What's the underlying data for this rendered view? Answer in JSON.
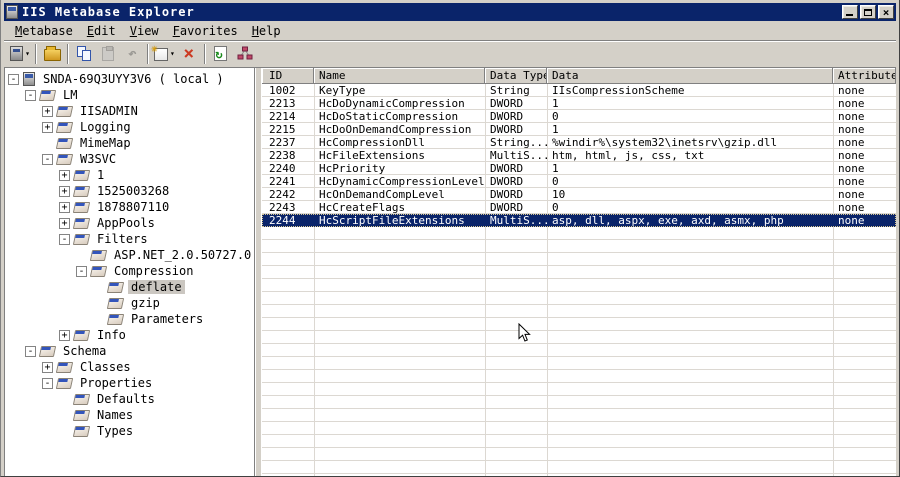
{
  "window": {
    "title": "IIS Metabase Explorer",
    "controls": {
      "minimize": "minimize",
      "maximize": "maximize",
      "close": "close"
    }
  },
  "menu": {
    "items": [
      "Metabase",
      "Edit",
      "View",
      "Favorites",
      "Help"
    ]
  },
  "toolbar": {
    "icons": [
      "connect-server",
      "open-folder",
      "copy",
      "paste",
      "undo",
      "new-key",
      "delete",
      "refresh",
      "view-hierarchy"
    ],
    "disabled": [
      "paste",
      "undo"
    ],
    "delete_glyph": "×",
    "undo_glyph": "↷"
  },
  "colors": {
    "titlebar": "#0A246A",
    "chrome": "#D4D0C8",
    "selection": "#0A246A",
    "grid_line": "#DCD8D2",
    "inactive_selection": "#CBC7C1",
    "delete_red": "#CC3A22",
    "refresh_green": "#1A8A1A"
  },
  "tree": {
    "nodes": [
      {
        "label": "SNDA-69Q3UYY3V6 ( local )",
        "level": 0,
        "expander": "minus",
        "icon": "computer",
        "selected": false
      },
      {
        "label": "LM",
        "level": 1,
        "expander": "minus",
        "icon": "key",
        "selected": false
      },
      {
        "label": "IISADMIN",
        "level": 2,
        "expander": "plus",
        "icon": "key",
        "selected": false
      },
      {
        "label": "Logging",
        "level": 2,
        "expander": "plus",
        "icon": "key",
        "selected": false
      },
      {
        "label": "MimeMap",
        "level": 2,
        "expander": "none",
        "icon": "key",
        "selected": false
      },
      {
        "label": "W3SVC",
        "level": 2,
        "expander": "minus",
        "icon": "key",
        "selected": false
      },
      {
        "label": "1",
        "level": 3,
        "expander": "plus",
        "icon": "key",
        "selected": false
      },
      {
        "label": "1525003268",
        "level": 3,
        "expander": "plus",
        "icon": "key",
        "selected": false
      },
      {
        "label": "1878807110",
        "level": 3,
        "expander": "plus",
        "icon": "key",
        "selected": false
      },
      {
        "label": "AppPools",
        "level": 3,
        "expander": "plus",
        "icon": "key",
        "selected": false
      },
      {
        "label": "Filters",
        "level": 3,
        "expander": "minus",
        "icon": "key",
        "selected": false
      },
      {
        "label": "ASP.NET_2.0.50727.0",
        "level": 4,
        "expander": "none",
        "icon": "key",
        "selected": false
      },
      {
        "label": "Compression",
        "level": 4,
        "expander": "minus",
        "icon": "key",
        "selected": false
      },
      {
        "label": "deflate",
        "level": 5,
        "expander": "none",
        "icon": "key",
        "selected": true
      },
      {
        "label": "gzip",
        "level": 5,
        "expander": "none",
        "icon": "key",
        "selected": false
      },
      {
        "label": "Parameters",
        "level": 5,
        "expander": "none",
        "icon": "key",
        "selected": false
      },
      {
        "label": "Info",
        "level": 3,
        "expander": "plus",
        "icon": "key",
        "selected": false
      },
      {
        "label": "Schema",
        "level": 1,
        "expander": "minus",
        "icon": "key",
        "selected": false
      },
      {
        "label": "Classes",
        "level": 2,
        "expander": "plus",
        "icon": "key",
        "selected": false
      },
      {
        "label": "Properties",
        "level": 2,
        "expander": "minus",
        "icon": "key",
        "selected": false
      },
      {
        "label": "Defaults",
        "level": 3,
        "expander": "none",
        "icon": "key",
        "selected": false
      },
      {
        "label": "Names",
        "level": 3,
        "expander": "none",
        "icon": "key",
        "selected": false
      },
      {
        "label": "Types",
        "level": 3,
        "expander": "none",
        "icon": "key",
        "selected": false
      }
    ]
  },
  "list": {
    "columns": [
      {
        "label": "ID"
      },
      {
        "label": "Name"
      },
      {
        "label": "Data Type"
      },
      {
        "label": "Data"
      },
      {
        "label": "Attributes"
      }
    ],
    "rows": [
      {
        "id": "1002",
        "name": "KeyType",
        "type": "String",
        "data": "IIsCompressionScheme",
        "attributes": "none",
        "selected": false
      },
      {
        "id": "2213",
        "name": "HcDoDynamicCompression",
        "type": "DWORD",
        "data": "1",
        "attributes": "none",
        "selected": false
      },
      {
        "id": "2214",
        "name": "HcDoStaticCompression",
        "type": "DWORD",
        "data": "0",
        "attributes": "none",
        "selected": false
      },
      {
        "id": "2215",
        "name": "HcDoOnDemandCompression",
        "type": "DWORD",
        "data": "1",
        "attributes": "none",
        "selected": false
      },
      {
        "id": "2237",
        "name": "HcCompressionDll",
        "type": "String...",
        "data": "%windir%\\system32\\inetsrv\\gzip.dll",
        "attributes": "none",
        "selected": false
      },
      {
        "id": "2238",
        "name": "HcFileExtensions",
        "type": "MultiS...",
        "data": "htm, html, js, css, txt",
        "attributes": "none",
        "selected": false
      },
      {
        "id": "2240",
        "name": "HcPriority",
        "type": "DWORD",
        "data": "1",
        "attributes": "none",
        "selected": false
      },
      {
        "id": "2241",
        "name": "HcDynamicCompressionLevel",
        "type": "DWORD",
        "data": "0",
        "attributes": "none",
        "selected": false
      },
      {
        "id": "2242",
        "name": "HcOnDemandCompLevel",
        "type": "DWORD",
        "data": "10",
        "attributes": "none",
        "selected": false
      },
      {
        "id": "2243",
        "name": "HcCreateFlags",
        "type": "DWORD",
        "data": "0",
        "attributes": "none",
        "selected": false
      },
      {
        "id": "2244",
        "name": "HcScriptFileExtensions",
        "type": "MultiS...",
        "data": "asp, dll, aspx, exe, axd, asmx, php",
        "attributes": "none",
        "selected": true
      }
    ]
  }
}
